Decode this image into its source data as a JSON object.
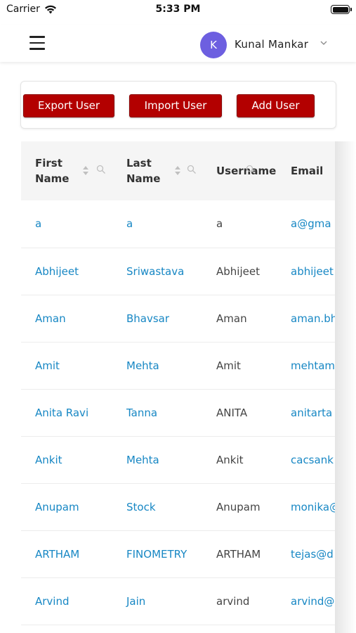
{
  "status_bar": {
    "carrier": "Carrier",
    "time": "5:33 PM"
  },
  "header": {
    "avatar_initial": "K",
    "user_name": "Kunal Mankar"
  },
  "actions": {
    "export_label": "Export User",
    "import_label": "Import User",
    "add_label": "Add User"
  },
  "table": {
    "columns": {
      "first_name": "First Name",
      "last_name": "Last Name",
      "username": "Username",
      "email": "Email"
    },
    "rows": [
      {
        "first_name": "a",
        "last_name": "a",
        "username": "a",
        "email": "a@gma"
      },
      {
        "first_name": "Abhijeet",
        "last_name": "Sriwastava",
        "username": "Abhijeet",
        "email": "abhijeet"
      },
      {
        "first_name": "Aman",
        "last_name": "Bhavsar",
        "username": "Aman",
        "email": "aman.bh"
      },
      {
        "first_name": "Amit",
        "last_name": "Mehta",
        "username": "Amit",
        "email": "mehtam"
      },
      {
        "first_name": "Anita Ravi",
        "last_name": "Tanna",
        "username": "ANITA",
        "email": "anitarta"
      },
      {
        "first_name": "Ankit",
        "last_name": "Mehta",
        "username": "Ankit",
        "email": "cacsank"
      },
      {
        "first_name": "Anupam",
        "last_name": "Stock",
        "username": "Anupam",
        "email": "monika@"
      },
      {
        "first_name": "ARTHAM",
        "last_name": "FINOMETRY",
        "username": "ARTHAM",
        "email": "tejas@d"
      },
      {
        "first_name": "Arvind",
        "last_name": "Jain",
        "username": "arvind",
        "email": "arvind@"
      }
    ]
  },
  "colors": {
    "brand_red": "#b30000",
    "link_blue": "#1787c4",
    "avatar_purple": "#6d5fe0"
  }
}
